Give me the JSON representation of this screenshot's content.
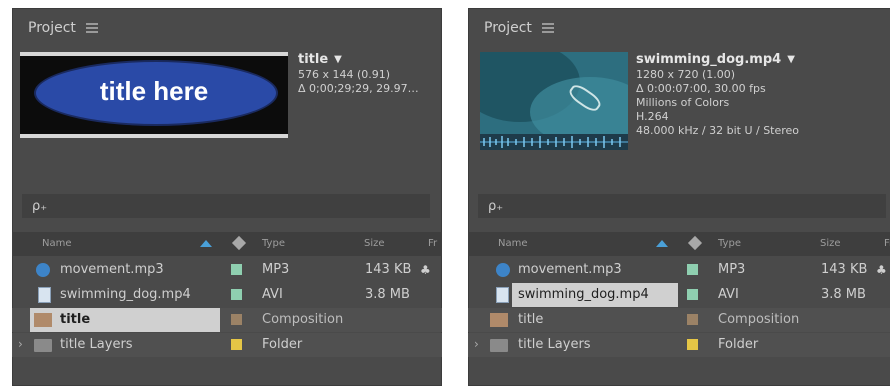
{
  "left": {
    "title": "Project",
    "thumb_text": "title here",
    "meta": {
      "name": "title",
      "line1": "576 x 144 (0.91)",
      "line2": "Δ 0;00;29;29, 29.97…"
    }
  },
  "right": {
    "title": "Project",
    "meta": {
      "name": "swimming_dog.mp4",
      "line1": "1280 x 720 (1.00)",
      "line2": "Δ 0:00:07:00, 30.00 fps",
      "line3": "Millions of Colors",
      "line4": "H.264",
      "line5": "48.000 kHz / 32 bit U / Stereo"
    }
  },
  "search": {
    "icon": "ρ₊"
  },
  "columns": {
    "name": "Name",
    "type": "Type",
    "size": "Size",
    "extra": "Fr"
  },
  "items": [
    {
      "name": "movement.mp3",
      "type": "MP3",
      "size": "143 KB",
      "label_color": "#8fcfb0"
    },
    {
      "name": "swimming_dog.mp4",
      "type": "AVI",
      "size": "3.8 MB",
      "label_color": "#8fcfb0"
    },
    {
      "name": "title",
      "type": "Composition",
      "size": "",
      "label_color": "#9b8266"
    },
    {
      "name": "title Layers",
      "type": "Folder",
      "size": "",
      "label_color": "#e5c646"
    }
  ],
  "glyphs": {
    "caret": "▼",
    "chevron": "›",
    "flowchart": "♣"
  }
}
